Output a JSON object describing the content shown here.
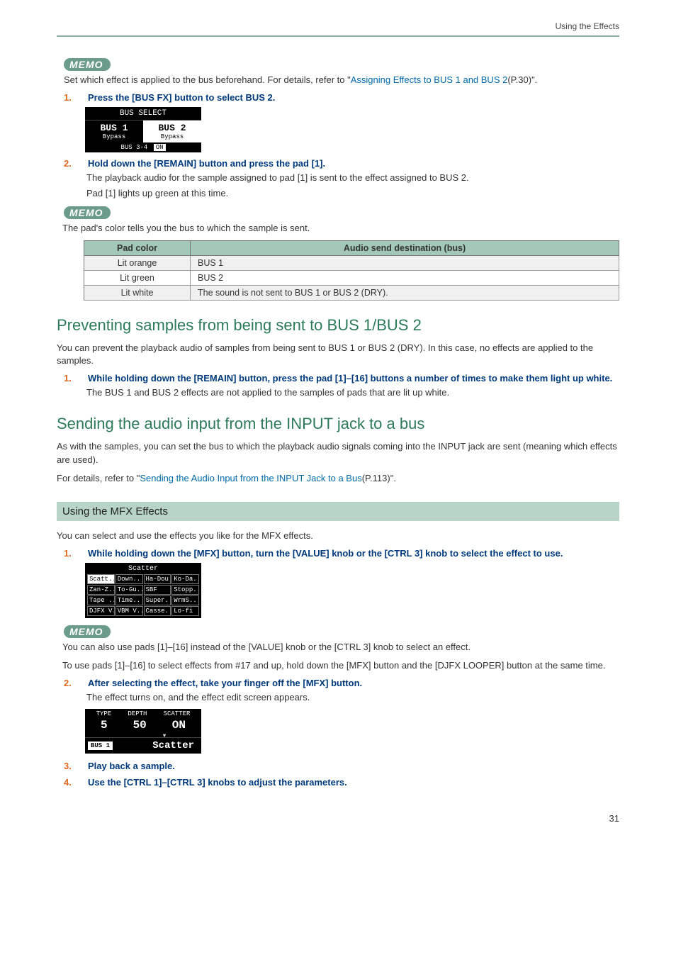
{
  "page": {
    "header": "Using the Effects",
    "number": "31"
  },
  "memo_label": "MEMO",
  "memo1_pre": "Set which effect is applied to the bus beforehand. For details, refer to \"",
  "memo1_link": "Assigning Effects to BUS 1 and BUS 2",
  "memo1_post": "(P.30)\".",
  "step1": {
    "num": "1.",
    "text": "Press the [BUS FX] button to select BUS 2."
  },
  "bus_select": {
    "title": "BUS SELECT",
    "bus1": "BUS 1",
    "bus2": "BUS 2",
    "bypass": "Bypass",
    "footer_label": "BUS 3-4",
    "footer_state": "ON"
  },
  "step2": {
    "num": "2.",
    "text": "Hold down the [REMAIN] button and press the pad [1].",
    "body1": "The playback audio for the sample assigned to pad [1] is sent to the effect assigned to BUS 2.",
    "body2": "Pad [1] lights up green at this time."
  },
  "memo2_text": "The pad's color tells you the bus to which the sample is sent.",
  "pad_table": {
    "h1": "Pad color",
    "h2": "Audio send destination (bus)",
    "rows": [
      {
        "c1": "Lit orange",
        "c2": "BUS 1"
      },
      {
        "c1": "Lit green",
        "c2": "BUS 2"
      },
      {
        "c1": "Lit white",
        "c2": "The sound is not sent to BUS 1 or BUS 2 (DRY)."
      }
    ]
  },
  "h_prevent": "Preventing samples from being sent to BUS 1/BUS 2",
  "prevent_para": "You can prevent the playback audio of samples from being sent to BUS 1 or BUS 2 (DRY). In this case, no effects are applied to the samples.",
  "prevent_step": {
    "num": "1.",
    "text": "While holding down the [REMAIN] button, press the pad [1]–[16] buttons a number of times to make them light up white.",
    "body": "The BUS 1 and BUS 2 effects are not applied to the samples of pads that are lit up white."
  },
  "h_send": "Sending the audio input from the INPUT jack to a bus",
  "send_para": "As with the samples, you can set the bus to which the playback audio signals coming into the INPUT jack are sent (meaning which effects are used).",
  "send_ref_pre": "For details, refer to \"",
  "send_ref_link": "Sending the Audio Input from the INPUT Jack to a Bus",
  "send_ref_post": "(P.113)\".",
  "h_mfx": "Using the MFX Effects",
  "mfx_para": "You can select and use the effects you like for the MFX effects.",
  "mfx_step1": {
    "num": "1.",
    "text": "While holding down the [MFX] button, turn the [VALUE] knob or the [CTRL 3] knob to select the effect to use."
  },
  "scatter": {
    "title": "Scatter",
    "cells": [
      "Scatt..",
      "Down..",
      "Ha-Dou",
      "Ko-Da..",
      "Zan-Z..",
      "To-Gu..",
      "SBF",
      "Stopp..",
      "Tape ..",
      "Time..",
      "Super..",
      "WrmS..",
      "DJFX V..",
      "VBM V..",
      "Casse..",
      "Lo-fi"
    ]
  },
  "memo3_l1": "You can also use pads [1]–[16] instead of the [VALUE] knob or the [CTRL 3] knob to select an effect.",
  "memo3_l2": "To use pads [1]–[16] to select effects from #17 and up, hold down the [MFX] button and the [DJFX LOOPER] button at the same time.",
  "mfx_step2": {
    "num": "2.",
    "text": "After selecting the effect, take your finger off the [MFX] button.",
    "body": "The effect turns on, and the effect edit screen appears."
  },
  "fxedit": {
    "h1": "TYPE",
    "h2": "DEPTH",
    "h3": "SCATTER",
    "v1": "5",
    "v2": "50",
    "v3": "ON",
    "bus": "BUS 1",
    "name": "Scatter"
  },
  "mfx_step3": {
    "num": "3.",
    "text": "Play back a sample."
  },
  "mfx_step4": {
    "num": "4.",
    "text": "Use the [CTRL 1]–[CTRL 3] knobs to adjust the parameters."
  }
}
